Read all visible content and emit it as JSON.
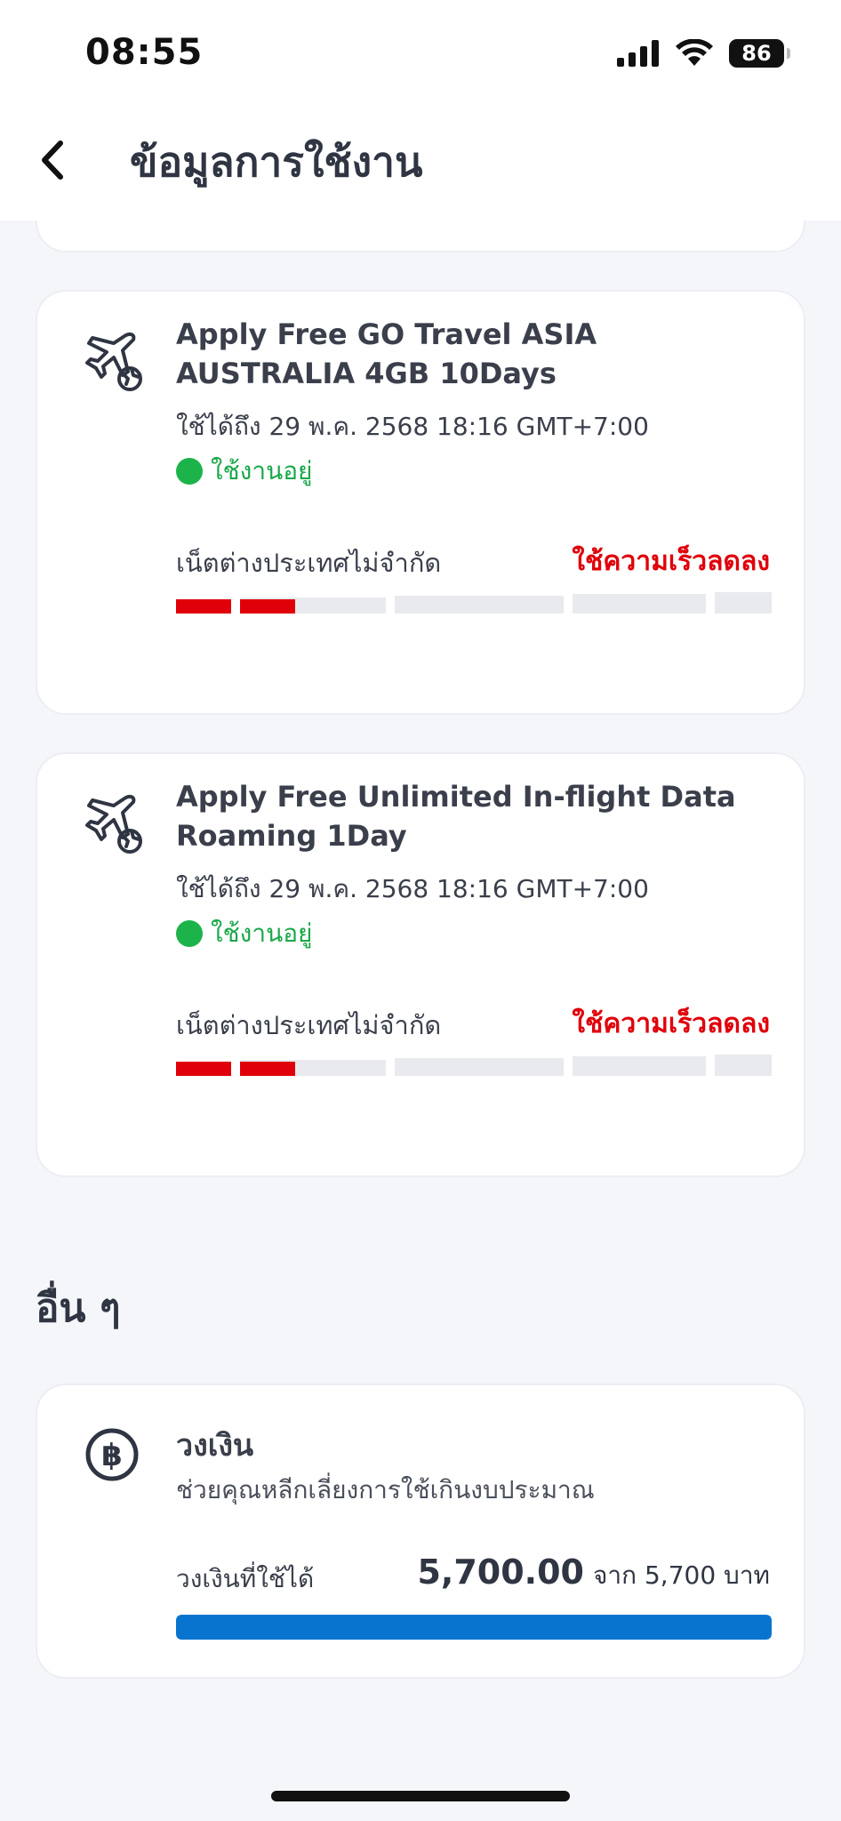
{
  "status_bar": {
    "time": "08:55",
    "battery": "86"
  },
  "header": {
    "title": "ข้อมูลการใช้งาน"
  },
  "packages": [
    {
      "title": "Apply Free GO Travel ASIA AUSTRALIA 4GB 10Days",
      "valid_until": "ใช้ได้ถึง 29 พ.ค. 2568 18:16 GMT+7:00",
      "status": "ใช้งานอยู่",
      "usage_label": "เน็ตต่างประเทศไม่จำกัด",
      "usage_note": "ใช้ความเร็วลดลง",
      "used_fraction": 0.2
    },
    {
      "title": "Apply Free Unlimited In-flight Data Roaming 1Day",
      "valid_until": "ใช้ได้ถึง 29 พ.ค. 2568 18:16 GMT+7:00",
      "status": "ใช้งานอยู่",
      "usage_label": "เน็ตต่างประเทศไม่จำกัด",
      "usage_note": "ใช้ความเร็วลดลง",
      "used_fraction": 0.2
    }
  ],
  "others": {
    "section_title": "อื่น ๆ",
    "credit": {
      "title": "วงเงิน",
      "subtitle": "ช่วยคุณหลีกเลี่ยงการใช้เกินงบประมาณ",
      "available_label": "วงเงินที่ใช้ได้",
      "available_amount": "5,700.00",
      "of_text": "จาก 5,700 บาท",
      "remaining_fraction": 1.0
    }
  },
  "colors": {
    "accent_red": "#e0000a",
    "active_green": "#1cb34a",
    "credit_blue": "#0874cf"
  },
  "icons": {
    "back": "chevron-left-icon",
    "package": "airplane-globe-icon",
    "credit": "baht-coin-icon"
  }
}
